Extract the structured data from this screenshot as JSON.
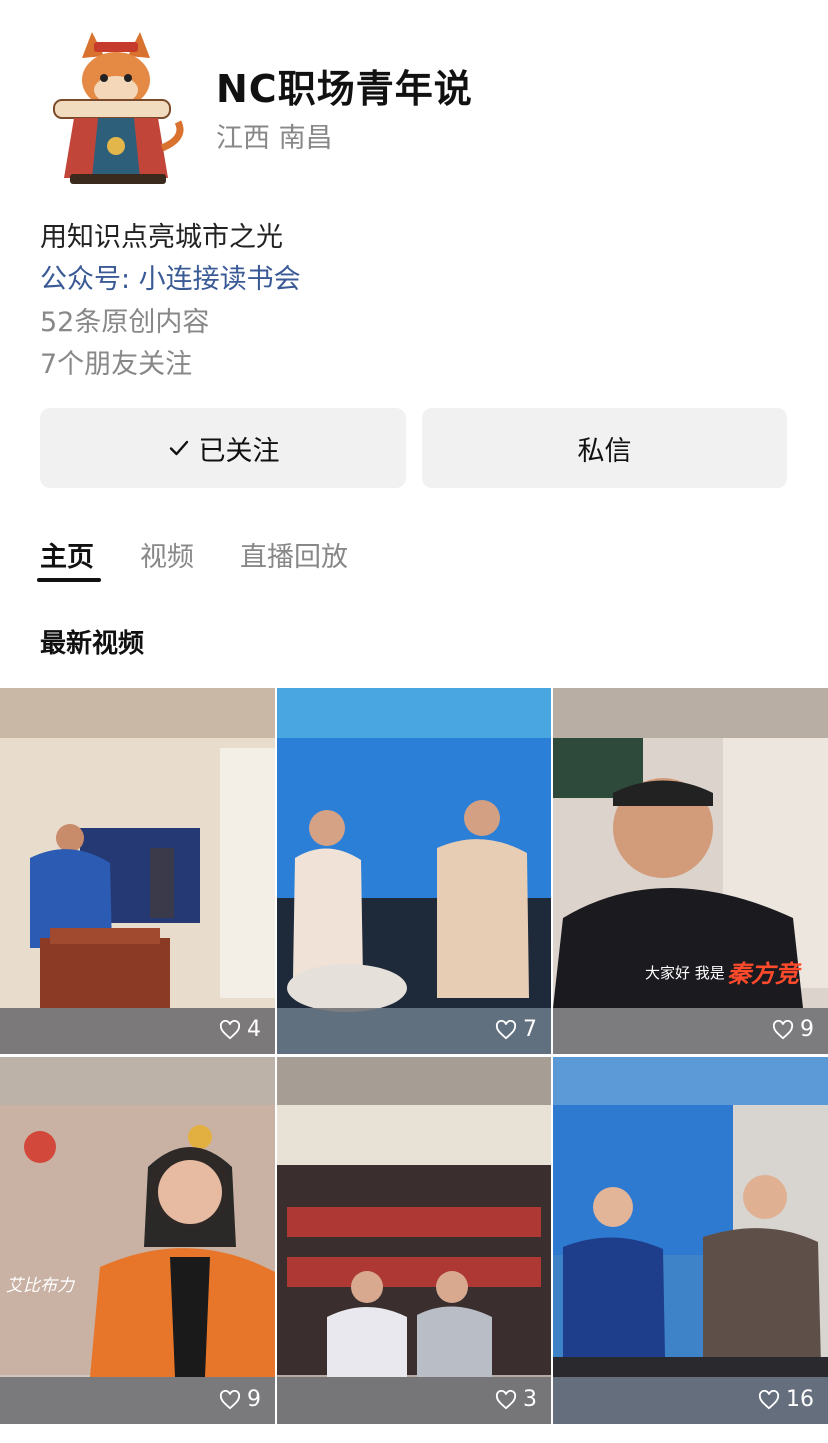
{
  "profile": {
    "name": "NC职场青年说",
    "location": "江西 南昌",
    "bio": "用知识点亮城市之光",
    "official_account": "公众号: 小连接读书会",
    "original_count": "52条原创内容",
    "friends_following": "7个朋友关注"
  },
  "actions": {
    "follow_label": "已关注",
    "message_label": "私信"
  },
  "tabs": [
    {
      "label": "主页",
      "active": true
    },
    {
      "label": "视频",
      "active": false
    },
    {
      "label": "直播回放",
      "active": false
    }
  ],
  "section": {
    "title": "最新视频"
  },
  "videos": [
    {
      "likes": "4"
    },
    {
      "likes": "7"
    },
    {
      "likes": "9",
      "overlay_caption": "大家好 我是",
      "overlay_name": "秦方竞"
    },
    {
      "likes": "9",
      "overlay_caption": "艾比布力"
    },
    {
      "likes": "3"
    },
    {
      "likes": "16"
    }
  ],
  "icons": {
    "check": "check-icon",
    "heart": "heart-outline-icon"
  }
}
